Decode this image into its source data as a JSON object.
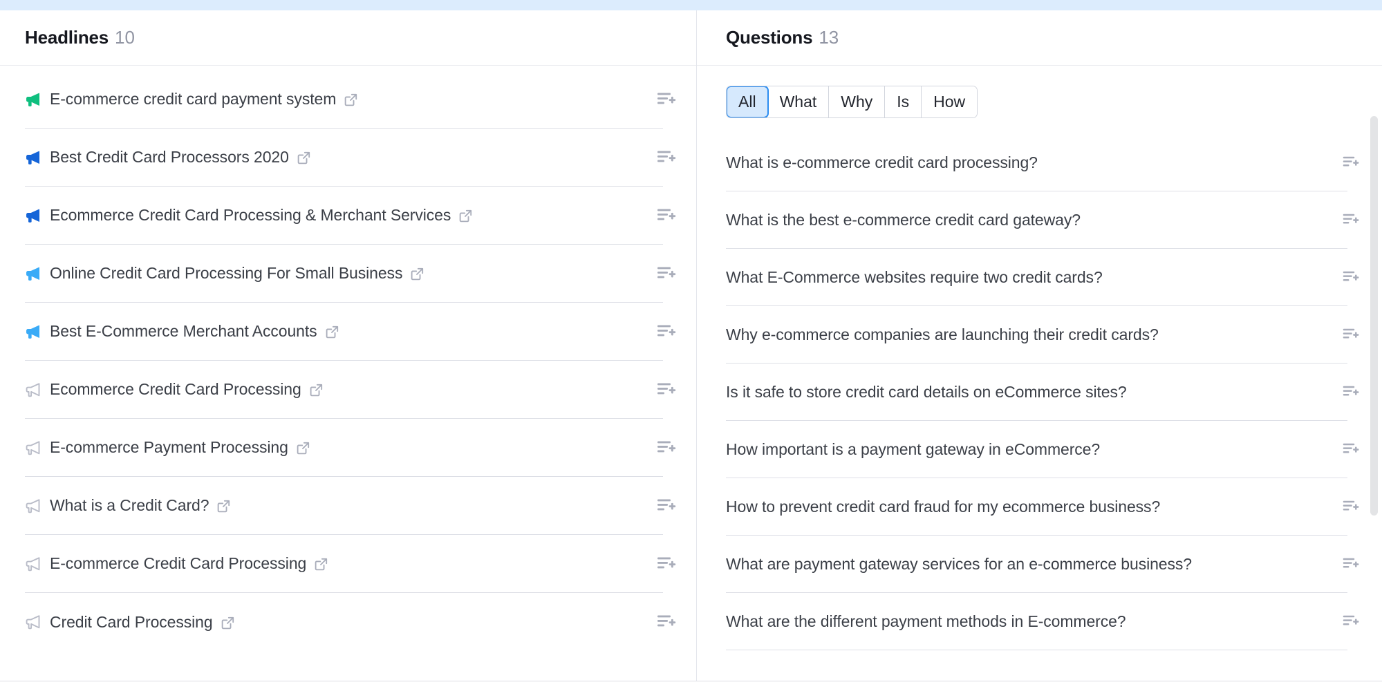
{
  "theme": {
    "accent_blue": "#2b8cf0",
    "top_strip": "#dcecfd",
    "text": "#3b3f47",
    "title": "#16181f",
    "count": "#9195a3",
    "divider": "#dddfe6",
    "icon_gray": "#a9adba",
    "megaphone_green": "#0fbf7f",
    "megaphone_blue_dark": "#1565d8",
    "megaphone_blue_light": "#3aabf7",
    "megaphone_gray": "#b9bcc8"
  },
  "headlines_panel": {
    "title": "Headlines",
    "count": "10",
    "items": [
      {
        "text": "E-commerce credit card payment system",
        "icon": "megaphone-icon",
        "icon_variant": "green",
        "link_icon": "external-link-icon",
        "action_icon": "add-to-list-icon"
      },
      {
        "text": "Best Credit Card Processors 2020",
        "icon": "megaphone-icon",
        "icon_variant": "blue-dark",
        "link_icon": "external-link-icon",
        "action_icon": "add-to-list-icon"
      },
      {
        "text": "Ecommerce Credit Card Processing & Merchant Services",
        "icon": "megaphone-icon",
        "icon_variant": "blue-dark",
        "link_icon": "external-link-icon",
        "action_icon": "add-to-list-icon"
      },
      {
        "text": "Online Credit Card Processing For Small Business",
        "icon": "megaphone-icon",
        "icon_variant": "blue-light",
        "link_icon": "external-link-icon",
        "action_icon": "add-to-list-icon"
      },
      {
        "text": "Best E-Commerce Merchant Accounts",
        "icon": "megaphone-icon",
        "icon_variant": "blue-light",
        "link_icon": "external-link-icon",
        "action_icon": "add-to-list-icon"
      },
      {
        "text": "Ecommerce Credit Card Processing",
        "icon": "megaphone-icon",
        "icon_variant": "gray",
        "link_icon": "external-link-icon",
        "action_icon": "add-to-list-icon"
      },
      {
        "text": "E-commerce Payment Processing",
        "icon": "megaphone-icon",
        "icon_variant": "gray",
        "link_icon": "external-link-icon",
        "action_icon": "add-to-list-icon"
      },
      {
        "text": "What is a Credit Card?",
        "icon": "megaphone-icon",
        "icon_variant": "gray",
        "link_icon": "external-link-icon",
        "action_icon": "add-to-list-icon"
      },
      {
        "text": "E-commerce Credit Card Processing",
        "icon": "megaphone-icon",
        "icon_variant": "gray",
        "link_icon": "external-link-icon",
        "action_icon": "add-to-list-icon"
      },
      {
        "text": "Credit Card Processing",
        "icon": "megaphone-icon",
        "icon_variant": "gray",
        "link_icon": "external-link-icon",
        "action_icon": "add-to-list-icon"
      }
    ]
  },
  "questions_panel": {
    "title": "Questions",
    "count": "13",
    "filters": [
      {
        "label": "All",
        "active": true
      },
      {
        "label": "What",
        "active": false
      },
      {
        "label": "Why",
        "active": false
      },
      {
        "label": "Is",
        "active": false
      },
      {
        "label": "How",
        "active": false
      }
    ],
    "items": [
      {
        "text": "What is e-commerce credit card processing?",
        "action_icon": "add-to-list-icon"
      },
      {
        "text": "What is the best e-commerce credit card gateway?",
        "action_icon": "add-to-list-icon"
      },
      {
        "text": "What E-Commerce websites require two credit cards?",
        "action_icon": "add-to-list-icon"
      },
      {
        "text": "Why e-commerce companies are launching their credit cards?",
        "action_icon": "add-to-list-icon"
      },
      {
        "text": "Is it safe to store credit card details on eCommerce sites?",
        "action_icon": "add-to-list-icon"
      },
      {
        "text": "How important is a payment gateway in eCommerce?",
        "action_icon": "add-to-list-icon"
      },
      {
        "text": "How to prevent credit card fraud for my ecommerce business?",
        "action_icon": "add-to-list-icon"
      },
      {
        "text": "What are payment gateway services for an e-commerce business?",
        "action_icon": "add-to-list-icon"
      },
      {
        "text": "What are the different payment methods in E-commerce?",
        "action_icon": "add-to-list-icon"
      }
    ],
    "scrollbar": {
      "name": "vertical-scrollbar",
      "visible": true
    }
  }
}
